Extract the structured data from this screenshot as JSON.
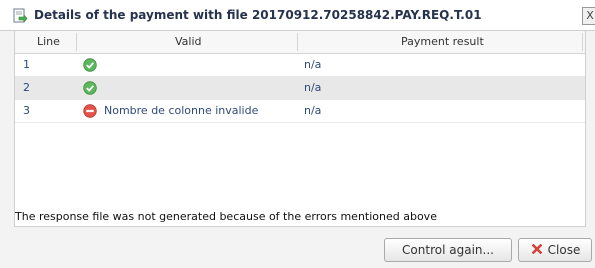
{
  "dialog": {
    "title": "Details of the payment with file 20170912.70258842.PAY.REQ.T.01",
    "close_glyph": "X",
    "icon": "document-arrow-icon"
  },
  "table": {
    "columns": [
      "Line",
      "Valid",
      "Payment result"
    ],
    "rows": [
      {
        "line": "1",
        "valid_icon": "check-circle-icon",
        "valid_text": "",
        "result": "n/a"
      },
      {
        "line": "2",
        "valid_icon": "check-circle-icon",
        "valid_text": "",
        "result": "n/a"
      },
      {
        "line": "3",
        "valid_icon": "error-circle-icon",
        "valid_text": "Nombre de colonne invalide",
        "result": "n/a"
      }
    ]
  },
  "status_message": "The response file was not generated because of the errors mentioned above",
  "buttons": {
    "control_again": "Control again...",
    "close": "Close"
  },
  "colors": {
    "ok_green": "#5cb85c",
    "error_red": "#e5534b",
    "link_blue": "#2f4a7a"
  }
}
